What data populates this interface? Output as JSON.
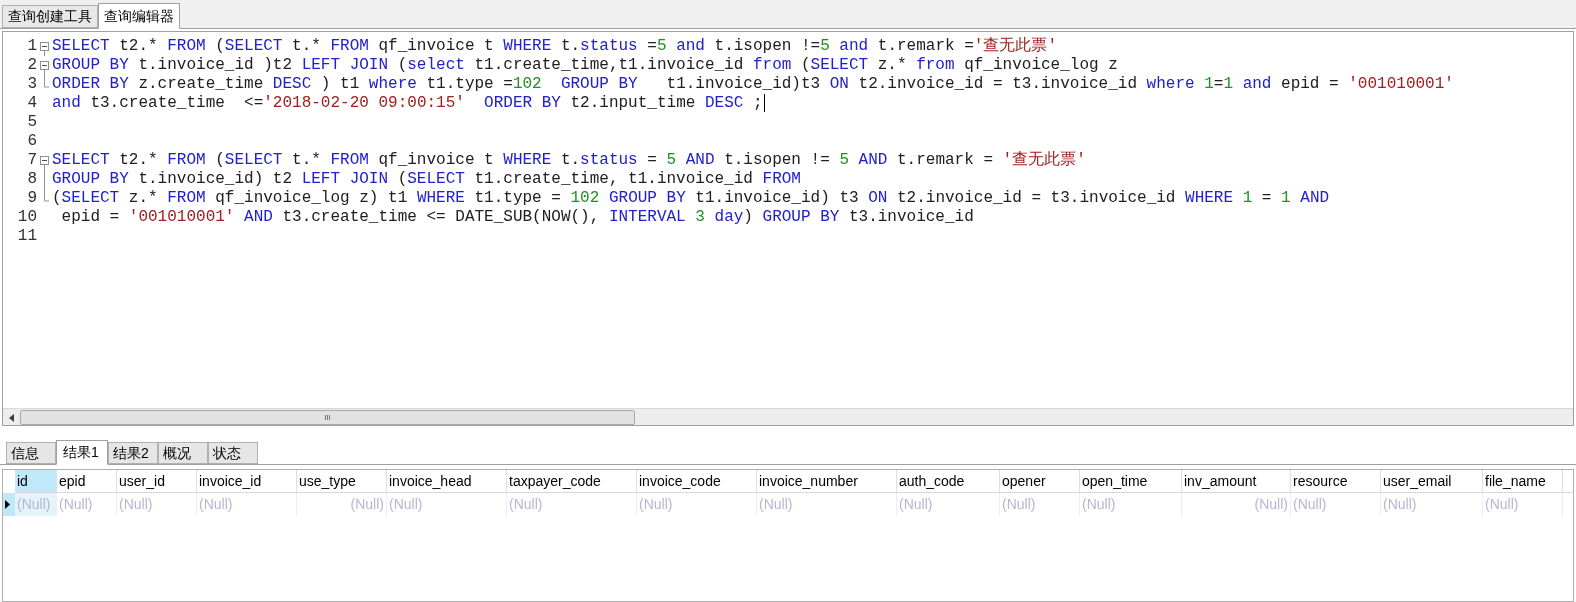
{
  "top_tabs": [
    {
      "label": "查询创建工具",
      "selected": false
    },
    {
      "label": "查询编辑器",
      "selected": true
    }
  ],
  "editor": {
    "lines": [
      {
        "number": "1",
        "kind": "fold_start",
        "tokens": [
          {
            "t": "SELECT",
            "kind": "keyword"
          },
          {
            "t": " t2.* ",
            "kind": "plain"
          },
          {
            "t": "FROM",
            "kind": "keyword"
          },
          {
            "t": " (",
            "kind": "plain"
          },
          {
            "t": "SELECT",
            "kind": "keyword"
          },
          {
            "t": " t.* ",
            "kind": "plain"
          },
          {
            "t": "FROM",
            "kind": "keyword"
          },
          {
            "t": " qf_invoice t ",
            "kind": "plain"
          },
          {
            "t": "WHERE",
            "kind": "keyword"
          },
          {
            "t": " t.",
            "kind": "plain"
          },
          {
            "t": "status",
            "kind": "keyword"
          },
          {
            "t": " =",
            "kind": "plain"
          },
          {
            "t": "5",
            "kind": "number"
          },
          {
            "t": " and",
            "kind": "keyword"
          },
          {
            "t": " t.isopen !=",
            "kind": "plain"
          },
          {
            "t": "5",
            "kind": "number"
          },
          {
            "t": " and",
            "kind": "keyword"
          },
          {
            "t": " t.remark =",
            "kind": "plain"
          },
          {
            "t": "'查无此票'",
            "kind": "string"
          }
        ]
      },
      {
        "number": "2",
        "kind": "fold_start",
        "tokens": [
          {
            "t": "GROUP BY",
            "kind": "keyword"
          },
          {
            "t": " t.invoice_id )t2 ",
            "kind": "plain"
          },
          {
            "t": "LEFT JOIN",
            "kind": "keyword"
          },
          {
            "t": " (",
            "kind": "plain"
          },
          {
            "t": "select",
            "kind": "keyword"
          },
          {
            "t": " t1.create_time,t1.invoice_id ",
            "kind": "plain"
          },
          {
            "t": "from",
            "kind": "keyword"
          },
          {
            "t": " (",
            "kind": "plain"
          },
          {
            "t": "SELECT",
            "kind": "keyword"
          },
          {
            "t": " z.* ",
            "kind": "plain"
          },
          {
            "t": "from",
            "kind": "keyword"
          },
          {
            "t": " qf_invoice_log z",
            "kind": "plain"
          }
        ]
      },
      {
        "number": "3",
        "kind": "fold_end",
        "tokens": [
          {
            "t": "ORDER BY",
            "kind": "keyword"
          },
          {
            "t": " z.create_time ",
            "kind": "plain"
          },
          {
            "t": "DESC",
            "kind": "keyword"
          },
          {
            "t": " ) t1 ",
            "kind": "plain"
          },
          {
            "t": "where",
            "kind": "keyword"
          },
          {
            "t": " t1.type =",
            "kind": "plain"
          },
          {
            "t": "102",
            "kind": "number"
          },
          {
            "t": "  GROUP BY",
            "kind": "keyword"
          },
          {
            "t": "   t1.invoice_id)t3 ",
            "kind": "plain"
          },
          {
            "t": "ON",
            "kind": "keyword"
          },
          {
            "t": " t2.invoice_id = t3.invoice_id ",
            "kind": "plain"
          },
          {
            "t": "where",
            "kind": "keyword"
          },
          {
            "t": " 1",
            "kind": "number"
          },
          {
            "t": "=",
            "kind": "plain"
          },
          {
            "t": "1",
            "kind": "number"
          },
          {
            "t": " and",
            "kind": "keyword"
          },
          {
            "t": " epid = ",
            "kind": "plain"
          },
          {
            "t": "'001010001'",
            "kind": "string"
          }
        ]
      },
      {
        "number": "4",
        "kind": "plain",
        "cursor": true,
        "tokens": [
          {
            "t": "and",
            "kind": "keyword"
          },
          {
            "t": " t3.create_time  <=",
            "kind": "plain"
          },
          {
            "t": "'2018-02-20 09:00:15'",
            "kind": "string"
          },
          {
            "t": "  ORDER BY",
            "kind": "keyword"
          },
          {
            "t": " t2.input_time ",
            "kind": "plain"
          },
          {
            "t": "DESC",
            "kind": "keyword"
          },
          {
            "t": " ;",
            "kind": "plain"
          }
        ]
      },
      {
        "number": "5",
        "kind": "plain"
      },
      {
        "number": "6",
        "kind": "plain"
      },
      {
        "number": "7",
        "kind": "fold_start",
        "tokens": [
          {
            "t": "SELECT",
            "kind": "keyword"
          },
          {
            "t": " t2.* ",
            "kind": "plain"
          },
          {
            "t": "FROM",
            "kind": "keyword"
          },
          {
            "t": " (",
            "kind": "plain"
          },
          {
            "t": "SELECT",
            "kind": "keyword"
          },
          {
            "t": " t.* ",
            "kind": "plain"
          },
          {
            "t": "FROM",
            "kind": "keyword"
          },
          {
            "t": " qf_invoice t ",
            "kind": "plain"
          },
          {
            "t": "WHERE",
            "kind": "keyword"
          },
          {
            "t": " t.",
            "kind": "plain"
          },
          {
            "t": "status",
            "kind": "keyword"
          },
          {
            "t": " = ",
            "kind": "plain"
          },
          {
            "t": "5",
            "kind": "number"
          },
          {
            "t": " AND",
            "kind": "keyword"
          },
          {
            "t": " t.isopen != ",
            "kind": "plain"
          },
          {
            "t": "5",
            "kind": "number"
          },
          {
            "t": " AND",
            "kind": "keyword"
          },
          {
            "t": " t.remark = ",
            "kind": "plain"
          },
          {
            "t": "'查无此票'",
            "kind": "string"
          }
        ]
      },
      {
        "number": "8",
        "kind": "fold_inner",
        "tokens": [
          {
            "t": "GROUP BY",
            "kind": "keyword"
          },
          {
            "t": " t.invoice_id) t2 ",
            "kind": "plain"
          },
          {
            "t": "LEFT JOIN",
            "kind": "keyword"
          },
          {
            "t": " (",
            "kind": "plain"
          },
          {
            "t": "SELECT",
            "kind": "keyword"
          },
          {
            "t": " t1.create_time, t1.invoice_id ",
            "kind": "plain"
          },
          {
            "t": "FROM",
            "kind": "keyword"
          }
        ]
      },
      {
        "number": "9",
        "kind": "fold_end",
        "tokens": [
          {
            "t": "(",
            "kind": "plain"
          },
          {
            "t": "SELECT",
            "kind": "keyword"
          },
          {
            "t": " z.* ",
            "kind": "plain"
          },
          {
            "t": "FROM",
            "kind": "keyword"
          },
          {
            "t": " qf_invoice_log z) t1 ",
            "kind": "plain"
          },
          {
            "t": "WHERE",
            "kind": "keyword"
          },
          {
            "t": " t1.type = ",
            "kind": "plain"
          },
          {
            "t": "102",
            "kind": "number"
          },
          {
            "t": " GROUP BY",
            "kind": "keyword"
          },
          {
            "t": " t1.invoice_id) t3 ",
            "kind": "plain"
          },
          {
            "t": "ON",
            "kind": "keyword"
          },
          {
            "t": " t2.invoice_id = t3.invoice_id ",
            "kind": "plain"
          },
          {
            "t": "WHERE",
            "kind": "keyword"
          },
          {
            "t": " 1",
            "kind": "number"
          },
          {
            "t": " = ",
            "kind": "plain"
          },
          {
            "t": "1",
            "kind": "number"
          },
          {
            "t": " AND",
            "kind": "keyword"
          }
        ]
      },
      {
        "number": "10",
        "kind": "plain",
        "tokens": [
          {
            "t": " epid = ",
            "kind": "plain"
          },
          {
            "t": "'001010001'",
            "kind": "string"
          },
          {
            "t": " AND",
            "kind": "keyword"
          },
          {
            "t": " t3.create_time <= DATE_SUB(NOW(), ",
            "kind": "plain"
          },
          {
            "t": "INTERVAL",
            "kind": "keyword"
          },
          {
            "t": " 3",
            "kind": "number"
          },
          {
            "t": " day",
            "kind": "keyword"
          },
          {
            "t": ") ",
            "kind": "plain"
          },
          {
            "t": "GROUP BY",
            "kind": "keyword"
          },
          {
            "t": " t3.invoice_id",
            "kind": "plain"
          }
        ]
      },
      {
        "number": "11",
        "kind": "plain"
      }
    ]
  },
  "scrollbar": {
    "grip": "III"
  },
  "result_tabs": [
    {
      "label": "信息",
      "selected": false
    },
    {
      "label": "结果1",
      "selected": true
    },
    {
      "label": "结果2",
      "selected": false
    },
    {
      "label": "概况",
      "selected": false
    },
    {
      "label": "状态",
      "selected": false
    }
  ],
  "grid": {
    "columns": [
      {
        "name": "id",
        "selected": true,
        "kind": "text"
      },
      {
        "name": "epid",
        "selected": false,
        "kind": "text"
      },
      {
        "name": "user_id",
        "selected": false,
        "kind": "text"
      },
      {
        "name": "invoice_id",
        "selected": false,
        "kind": "text"
      },
      {
        "name": "use_type",
        "selected": false,
        "kind": "number"
      },
      {
        "name": "invoice_head",
        "selected": false,
        "kind": "text"
      },
      {
        "name": "taxpayer_code",
        "selected": false,
        "kind": "text"
      },
      {
        "name": "invoice_code",
        "selected": false,
        "kind": "text"
      },
      {
        "name": "invoice_number",
        "selected": false,
        "kind": "text"
      },
      {
        "name": "auth_code",
        "selected": false,
        "kind": "text"
      },
      {
        "name": "opener",
        "selected": false,
        "kind": "text"
      },
      {
        "name": "open_time",
        "selected": false,
        "kind": "text"
      },
      {
        "name": "inv_amount",
        "selected": false,
        "kind": "number"
      },
      {
        "name": "resource",
        "selected": false,
        "kind": "text"
      },
      {
        "name": "user_email",
        "selected": false,
        "kind": "text"
      },
      {
        "name": "file_name",
        "selected": false,
        "kind": "text"
      }
    ],
    "rows": [
      {
        "current": true,
        "cells": [
          "(Null)",
          "(Null)",
          "(Null)",
          "(Null)",
          "(Null)",
          "(Null)",
          "(Null)",
          "(Null)",
          "(Null)",
          "(Null)",
          "(Null)",
          "(Null)",
          "(Null)",
          "(Null)",
          "(Null)",
          "(Null)"
        ]
      }
    ]
  }
}
